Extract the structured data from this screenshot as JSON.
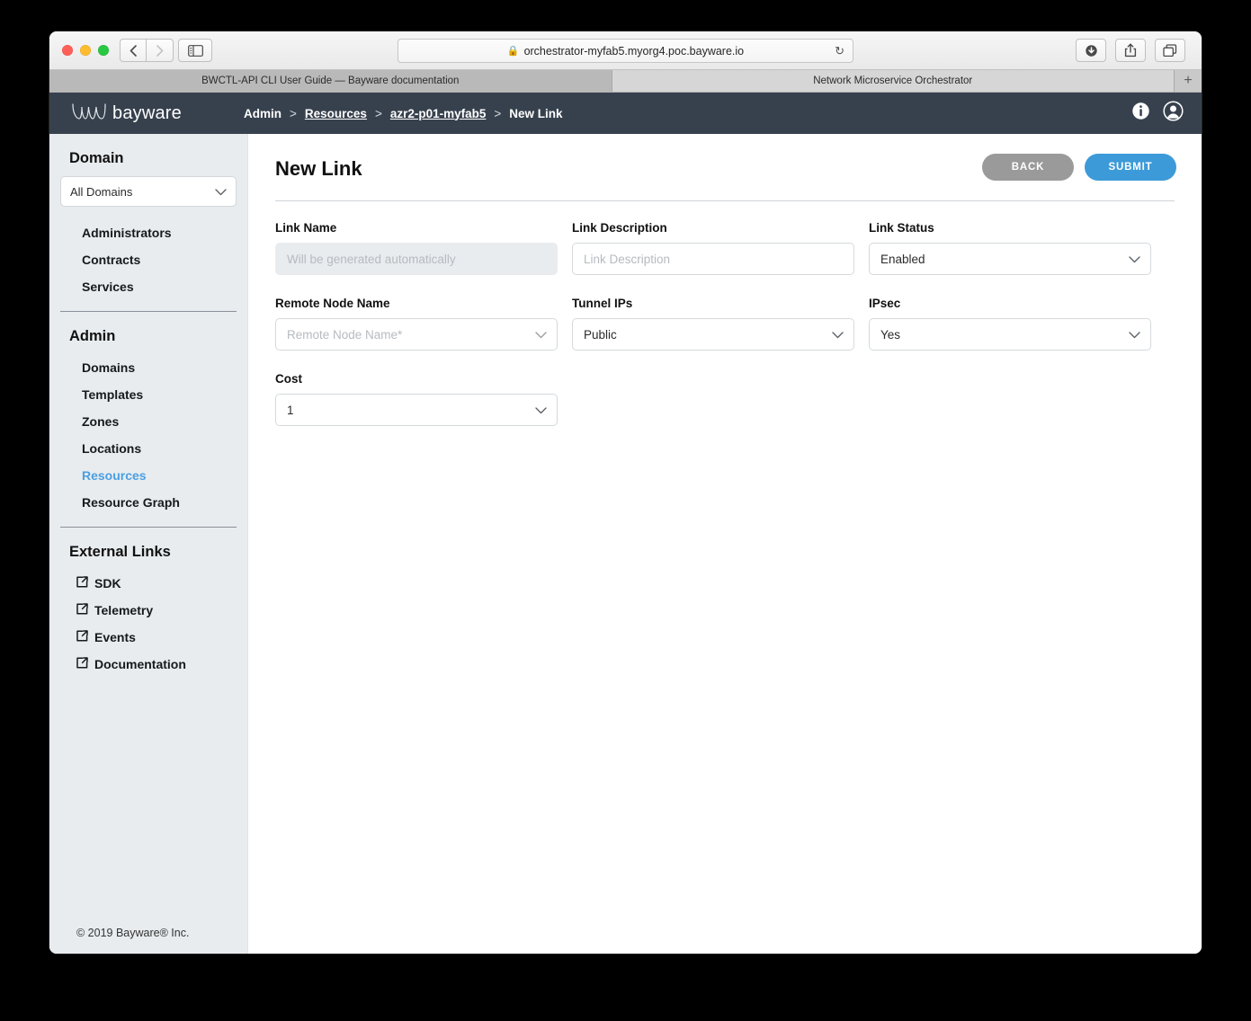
{
  "browser": {
    "url": "orchestrator-myfab5.myorg4.poc.bayware.io",
    "lock_icon": "lock-icon",
    "reload_icon": "reload-icon",
    "back_icon": "chevron-left-icon",
    "forward_icon": "chevron-right-icon",
    "sidebar_icon": "sidebar-toggle-icon",
    "download_icon": "download-icon",
    "share_icon": "share-icon",
    "tabs_icon": "tab-overview-icon",
    "new_tab_label": "+",
    "tabs": [
      {
        "title": "BWCTL-API CLI User Guide — Bayware documentation",
        "active": false
      },
      {
        "title": "Network Microservice Orchestrator",
        "active": true
      }
    ]
  },
  "app_header": {
    "logo_text": "bayware",
    "logo_icon": "bayware-wave-logo",
    "breadcrumb": [
      {
        "label": "Admin",
        "link": false
      },
      {
        "label": "Resources",
        "link": true
      },
      {
        "label": "azr2-p01-myfab5",
        "link": true
      },
      {
        "label": "New Link",
        "link": false
      }
    ],
    "separator": ">",
    "info_icon": "info-icon",
    "account_icon": "user-account-icon"
  },
  "sidebar": {
    "domain_title": "Domain",
    "domain_select": {
      "value": "All Domains",
      "chevron_icon": "chevron-down-icon"
    },
    "domain_items": [
      {
        "label": "Administrators",
        "active": false
      },
      {
        "label": "Contracts",
        "active": false
      },
      {
        "label": "Services",
        "active": false
      }
    ],
    "admin_title": "Admin",
    "admin_items": [
      {
        "label": "Domains",
        "active": false
      },
      {
        "label": "Templates",
        "active": false
      },
      {
        "label": "Zones",
        "active": false
      },
      {
        "label": "Locations",
        "active": false
      },
      {
        "label": "Resources",
        "active": true
      },
      {
        "label": "Resource Graph",
        "active": false
      }
    ],
    "external_title": "External Links",
    "external_items": [
      {
        "label": "SDK",
        "icon": "external-link-icon"
      },
      {
        "label": "Telemetry",
        "icon": "external-link-icon"
      },
      {
        "label": "Events",
        "icon": "external-link-icon"
      },
      {
        "label": "Documentation",
        "icon": "external-link-icon"
      }
    ],
    "copyright": "© 2019 Bayware® Inc."
  },
  "main": {
    "page_title": "New Link",
    "back_label": "BACK",
    "submit_label": "SUBMIT",
    "fields": {
      "link_name": {
        "label": "Link Name",
        "placeholder": "Will be generated automatically",
        "value": "",
        "disabled": true
      },
      "link_description": {
        "label": "Link Description",
        "placeholder": "Link Description",
        "value": ""
      },
      "link_status": {
        "label": "Link Status",
        "value": "Enabled",
        "chevron_icon": "chevron-down-icon"
      },
      "remote_node_name": {
        "label": "Remote Node Name",
        "placeholder": "Remote Node Name*",
        "value": "",
        "chevron_icon": "chevron-down-icon"
      },
      "tunnel_ips": {
        "label": "Tunnel IPs",
        "value": "Public",
        "chevron_icon": "chevron-down-icon"
      },
      "ipsec": {
        "label": "IPsec",
        "value": "Yes",
        "chevron_icon": "chevron-down-icon"
      },
      "cost": {
        "label": "Cost",
        "value": "1",
        "chevron_icon": "chevron-down-icon"
      }
    }
  },
  "colors": {
    "header_bg": "#37414e",
    "sidebar_bg": "#e8ecef",
    "accent_blue": "#4b9fe0",
    "submit_blue": "#3d9ad8",
    "back_gray": "#9a9a9a"
  }
}
